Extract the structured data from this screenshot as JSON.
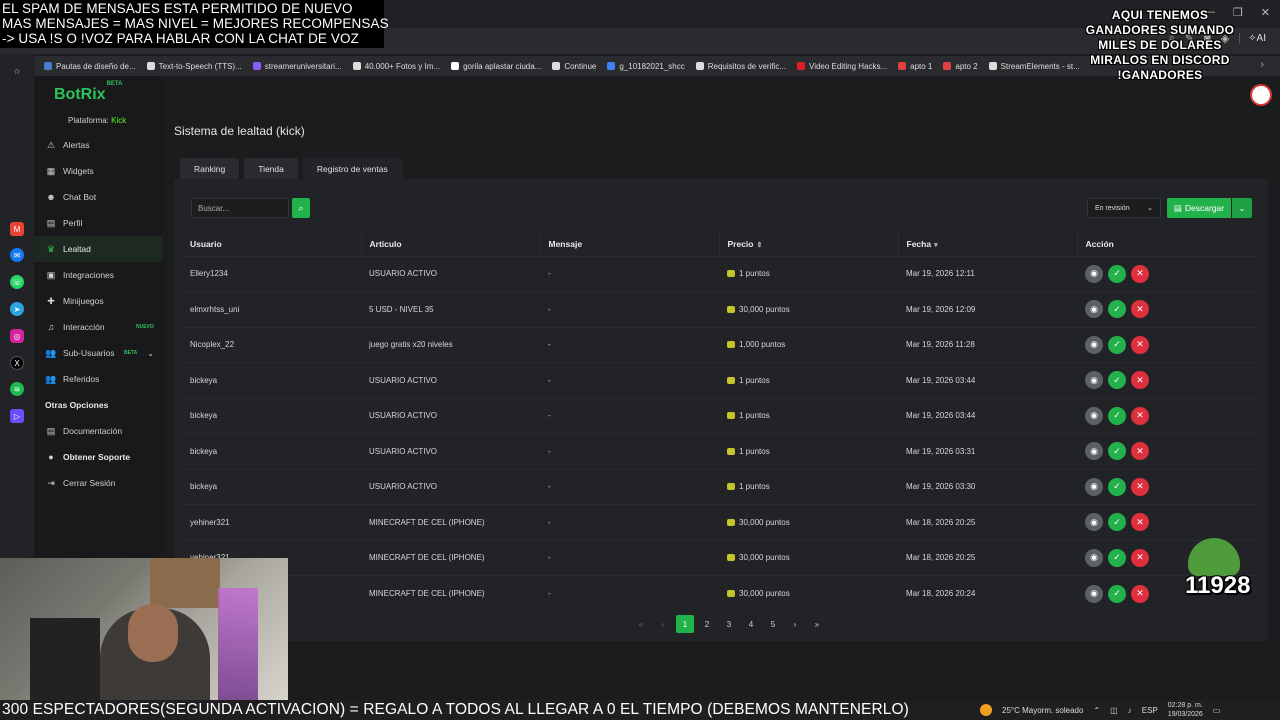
{
  "overlay_top": [
    "EL SPAM DE MENSAJES ESTA PERMITIDO DE NUEVO",
    "MAS MENSAJES = MAS NIVEL = MEJORES RECOMPENSAS",
    "-> USA !S O !VOZ PARA HABLAR CON LA CHAT DE VOZ"
  ],
  "overlay_right": [
    "AQUI TENEMOS",
    "GANADORES SUMANDO",
    "MILES DE DOLARES",
    "MIRALOS EN DISCORD",
    "!GANADORES"
  ],
  "browser": {
    "ai_label": "AI",
    "bookmarks": [
      {
        "label": "Pautas de diseño de...",
        "color": "#4a7bd0"
      },
      {
        "label": "Text-to-Speech (TTS)...",
        "color": "#dddddd"
      },
      {
        "label": "streameruniversitari...",
        "color": "#8a5cf6"
      },
      {
        "label": "40.000+ Fotos y Im...",
        "color": "#dddddd"
      },
      {
        "label": "gorila aplastar ciuda...",
        "color": "#ffffff"
      },
      {
        "label": "Continue",
        "color": "#dddddd"
      },
      {
        "label": "g_10182021_shcc",
        "color": "#3b82f6"
      },
      {
        "label": "Requisitos de verific...",
        "color": "#dddddd"
      },
      {
        "label": "Video Editing Hacks...",
        "color": "#e02020"
      },
      {
        "label": "apto 1",
        "color": "#e04040"
      },
      {
        "label": "apto 2",
        "color": "#e04040"
      },
      {
        "label": "StreamElements - st...",
        "color": "#dddddd"
      }
    ]
  },
  "sidebar": {
    "logo": "BotRix",
    "logo_badge": "BETA",
    "platform_label": "Plataforma:",
    "platform_value": "Kick",
    "items": [
      {
        "label": "Alertas",
        "icon": "⚠"
      },
      {
        "label": "Widgets",
        "icon": "▦"
      },
      {
        "label": "Chat Bot",
        "icon": "☻"
      },
      {
        "label": "Perfil",
        "icon": "▤"
      },
      {
        "label": "Lealtad",
        "icon": "♛"
      },
      {
        "label": "Integraciones",
        "icon": "▣"
      },
      {
        "label": "Minijuegos",
        "icon": "✚"
      },
      {
        "label": "Interacción",
        "icon": "♫",
        "badge": "NUEVO"
      },
      {
        "label": "Sub-Usuarios",
        "icon": "👥",
        "badge": "BETA"
      },
      {
        "label": "Referidos",
        "icon": "👥"
      }
    ],
    "other_title": "Otras Opciones",
    "other_items": [
      {
        "label": "Documentación",
        "icon": "▤"
      },
      {
        "label": "Obtener Soporte",
        "icon": "●"
      },
      {
        "label": "Cerrar Sesión",
        "icon": "⇥"
      }
    ]
  },
  "main": {
    "title": "Sistema de lealtad (kick)",
    "tabs": [
      "Ranking",
      "Tienda",
      "Registro de ventas"
    ],
    "search_placeholder": "Buscar...",
    "status_filter": "En revisión",
    "download_label": "Descargar",
    "columns": [
      "Usuario",
      "Artículo",
      "Mensaje",
      "Precio",
      "Fecha",
      "Acción"
    ],
    "rows": [
      {
        "user": "Ellery1234",
        "item": "USUARIO ACTIVO",
        "message": "-",
        "price": "1 puntos",
        "date": "Mar 19, 2026 12:11"
      },
      {
        "user": "elmxrhtss_uni",
        "item": "5 USD - NIVEL 35",
        "message": "-",
        "price": "30,000 puntos",
        "date": "Mar 19, 2026 12:09"
      },
      {
        "user": "Nicoplex_22",
        "item": "juego gratis x20 niveles",
        "message": "-",
        "price": "1,000 puntos",
        "date": "Mar 19, 2026 11:28"
      },
      {
        "user": "bickeya",
        "item": "USUARIO ACTIVO",
        "message": "-",
        "price": "1 puntos",
        "date": "Mar 19, 2026 03:44"
      },
      {
        "user": "bickeya",
        "item": "USUARIO ACTIVO",
        "message": "-",
        "price": "1 puntos",
        "date": "Mar 19, 2026 03:44"
      },
      {
        "user": "bickeya",
        "item": "USUARIO ACTIVO",
        "message": "-",
        "price": "1 puntos",
        "date": "Mar 19, 2026 03:31"
      },
      {
        "user": "bickeya",
        "item": "USUARIO ACTIVO",
        "message": "-",
        "price": "1 puntos",
        "date": "Mar 19, 2026 03:30"
      },
      {
        "user": "yehiner321",
        "item": "MINECRAFT DE CEL (IPHONE)",
        "message": "-",
        "price": "30,000 puntos",
        "date": "Mar 18, 2026 20:25"
      },
      {
        "user": "yehiner321",
        "item": "MINECRAFT DE CEL (IPHONE)",
        "message": "-",
        "price": "30,000 puntos",
        "date": "Mar 18, 2026 20:25"
      },
      {
        "user": "",
        "item": "MINECRAFT DE CEL (IPHONE)",
        "message": "-",
        "price": "30,000 puntos",
        "date": "Mar 18, 2026 20:24"
      }
    ],
    "pagination": {
      "pages": [
        "1",
        "2",
        "3",
        "4",
        "5"
      ],
      "current": "1",
      "first": "«",
      "prev": "‹",
      "next": "›",
      "last": "»"
    }
  },
  "sub_count": "11928",
  "bottom_text": "300 ESPECTADORES(SEGUNDA ACTIVACION) = REGALO A TODOS AL LLEGAR A 0 EL TIEMPO (DEBEMOS MANTENERLO)",
  "taskbar": {
    "weather": "25°C  Mayorm. soleado",
    "lang": "ESP",
    "time": "02:28 p. m.",
    "date": "19/03/2026"
  },
  "colors": {
    "accent": "#22b24c",
    "danger": "#e0303d",
    "kick": "#53fc18"
  }
}
